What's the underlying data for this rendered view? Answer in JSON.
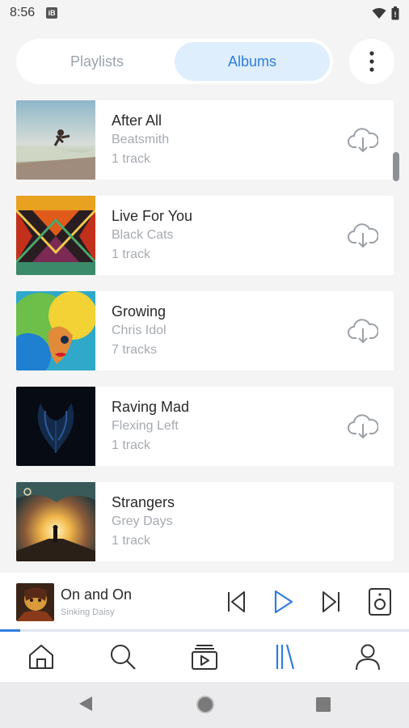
{
  "status_bar": {
    "time": "8:56",
    "notification_glyph": "iB",
    "icons": [
      "wifi-icon",
      "battery-icon"
    ]
  },
  "segmented": {
    "tabs": [
      {
        "label": "Playlists",
        "active": false
      },
      {
        "label": "Albums",
        "active": true
      }
    ]
  },
  "more_button": {
    "icon": "more-vertical-icon"
  },
  "albums": [
    {
      "title": "After All",
      "artist": "Beatsmith",
      "tracks": "1 track"
    },
    {
      "title": "Live For You",
      "artist": "Black Cats",
      "tracks": "1 track"
    },
    {
      "title": "Growing",
      "artist": "Chris Idol",
      "tracks": "7 tracks"
    },
    {
      "title": "Raving Mad",
      "artist": "Flexing Left",
      "tracks": "1 track"
    },
    {
      "title": "Strangers",
      "artist": "Grey Days",
      "tracks": "1 track"
    }
  ],
  "now_playing": {
    "title": "On and On",
    "artist": "Sinking Daisy",
    "progress": 0.05,
    "controls": [
      "previous-icon",
      "play-icon",
      "next-icon",
      "speaker-icon"
    ]
  },
  "bottom_nav": {
    "items": [
      {
        "icon": "home-icon",
        "active": false
      },
      {
        "icon": "search-icon",
        "active": false
      },
      {
        "icon": "video-library-icon",
        "active": false
      },
      {
        "icon": "library-icon",
        "active": true
      },
      {
        "icon": "profile-icon",
        "active": false
      }
    ]
  },
  "system_nav": {
    "icons": [
      "back-icon",
      "home-circle-icon",
      "recents-icon"
    ]
  },
  "colors": {
    "accent": "#2f7de1",
    "active_tab_bg": "#dfeefc",
    "background": "#f4f4f5",
    "secondary_text": "#a6aab0"
  }
}
